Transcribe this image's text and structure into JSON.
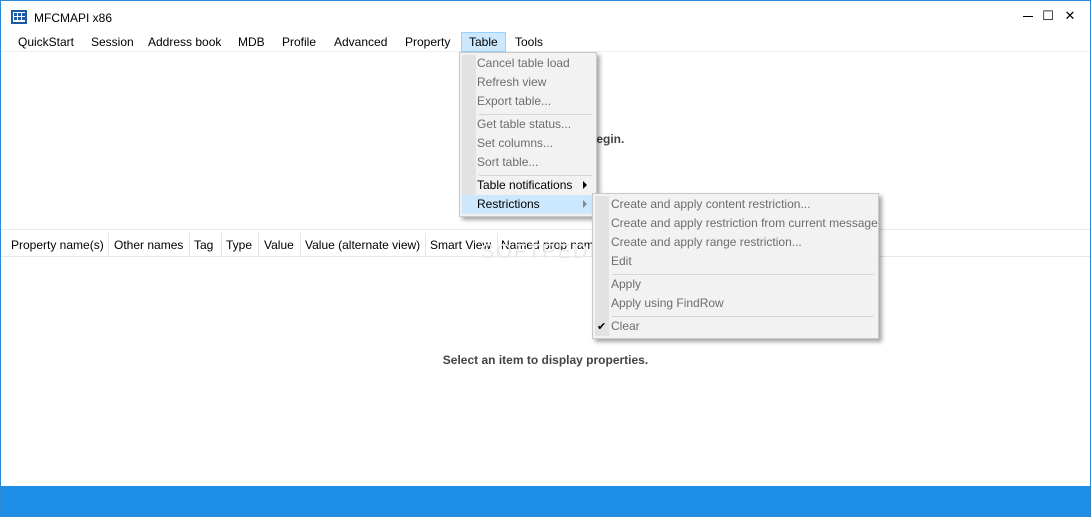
{
  "window": {
    "title": "MFCMAPI x86",
    "minimize_glyph": "—",
    "maximize_glyph": "☐",
    "close_glyph": "✕"
  },
  "menubar": {
    "items": [
      {
        "label": "QuickStart"
      },
      {
        "label": "Session"
      },
      {
        "label": "Address book"
      },
      {
        "label": "MDB"
      },
      {
        "label": "Profile"
      },
      {
        "label": "Advanced"
      },
      {
        "label": "Property"
      },
      {
        "label": "Table",
        "active": true
      },
      {
        "label": "Tools"
      }
    ]
  },
  "main": {
    "top_message_partial": "begin.",
    "bottom_message": "Select an item to display properties."
  },
  "properties_table": {
    "columns": [
      {
        "label": "Property name(s)"
      },
      {
        "label": "Other names"
      },
      {
        "label": "Tag"
      },
      {
        "label": "Type"
      },
      {
        "label": "Value"
      },
      {
        "label": "Value (alternate view)"
      },
      {
        "label": "Smart View"
      },
      {
        "label": "Named prop nam"
      }
    ]
  },
  "table_menu": {
    "items": [
      {
        "label": "Cancel table load",
        "enabled": false
      },
      {
        "label": "Refresh view",
        "enabled": false
      },
      {
        "label": "Export table...",
        "enabled": false
      },
      {
        "label": "Get table status...",
        "enabled": false
      },
      {
        "label": "Set columns...",
        "enabled": false
      },
      {
        "label": "Sort table...",
        "enabled": false
      },
      {
        "label": "Table notifications",
        "enabled": true,
        "submenu": true
      },
      {
        "label": "Restrictions",
        "enabled": true,
        "submenu": true,
        "highlighted": true
      }
    ]
  },
  "restrictions_menu": {
    "items": [
      {
        "label": "Create and apply content restriction...",
        "enabled": false
      },
      {
        "label": "Create and apply restriction from current message",
        "enabled": false
      },
      {
        "label": "Create and apply range restriction...",
        "enabled": false
      },
      {
        "label": "Edit",
        "enabled": false
      },
      {
        "label": "Apply",
        "enabled": false
      },
      {
        "label": "Apply using FindRow",
        "enabled": false
      },
      {
        "label": "Clear",
        "enabled": false,
        "checked": true,
        "check_glyph": "✔"
      }
    ]
  },
  "watermark": "SOFTPEDIA",
  "colors": {
    "accent": "#1e8ee7",
    "menu_highlight": "#cce8ff",
    "window_border": "#2b8ad8",
    "app_icon": "#1c5aa6"
  }
}
